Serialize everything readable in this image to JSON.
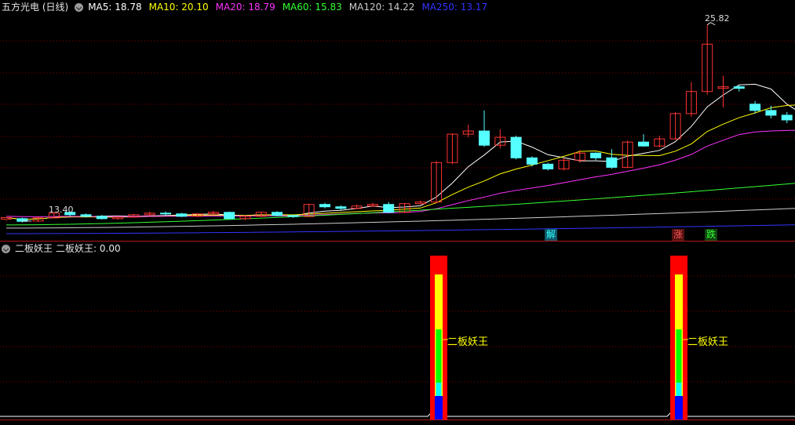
{
  "header": {
    "title": "五方光电 (日线)",
    "ma": [
      {
        "label": "MA5: 18.78",
        "color": "#ffffff"
      },
      {
        "label": "MA10: 20.10",
        "color": "#ffff00"
      },
      {
        "label": "MA20: 18.79",
        "color": "#ff33ff"
      },
      {
        "label": "MA60: 15.83",
        "color": "#33ff33"
      },
      {
        "label": "MA120: 14.22",
        "color": "#cccccc"
      },
      {
        "label": "MA250: 13.17",
        "color": "#3333ff"
      }
    ]
  },
  "price_labels": {
    "high": "25.82",
    "low": "13.40"
  },
  "markers": [
    {
      "text": "解",
      "color": "#33ffff",
      "bg": "#115566"
    },
    {
      "text": "涨",
      "color": "#ff5555",
      "bg": "#551111"
    },
    {
      "text": "跌",
      "color": "#33ff33",
      "bg": "#114411"
    }
  ],
  "indicator": {
    "name": "二板妖王",
    "value_label": "二板妖王: 0.00",
    "annotation": "二板妖王"
  },
  "colors": {
    "up": "#ff3333",
    "down": "#55ffff",
    "grid": "#8b0000",
    "separator": "#b01818",
    "ma5": "#ffffff",
    "ma10": "#ffff00",
    "ma20": "#ff33ff",
    "ma60": "#33ff33",
    "ma120": "#cccccc",
    "ma250": "#3333ff"
  },
  "chart_data": {
    "type": "candlestick",
    "candles": [
      [
        13.52,
        13.62,
        13.45,
        13.4
      ],
      [
        13.55,
        13.38,
        13.62,
        13.3
      ],
      [
        13.4,
        13.6,
        13.68,
        13.35
      ],
      [
        13.6,
        13.9,
        13.95,
        13.55
      ],
      [
        13.95,
        13.8,
        14.0,
        13.7
      ],
      [
        13.8,
        13.7,
        13.88,
        13.62
      ],
      [
        13.7,
        13.55,
        13.78,
        13.5
      ],
      [
        13.55,
        13.65,
        13.72,
        13.5
      ],
      [
        13.65,
        13.8,
        13.85,
        13.6
      ],
      [
        13.8,
        13.9,
        13.98,
        13.7
      ],
      [
        13.9,
        13.85,
        14.0,
        13.75
      ],
      [
        13.85,
        13.7,
        13.92,
        13.65
      ],
      [
        13.7,
        13.85,
        13.9,
        13.65
      ],
      [
        13.85,
        13.95,
        14.05,
        13.8
      ],
      [
        13.95,
        13.55,
        14.0,
        13.5
      ],
      [
        13.55,
        13.7,
        13.75,
        13.45
      ],
      [
        13.7,
        13.95,
        14.0,
        13.65
      ],
      [
        13.95,
        13.75,
        14.02,
        13.7
      ],
      [
        13.75,
        13.68,
        13.8,
        13.6
      ],
      [
        13.68,
        14.45,
        14.5,
        13.65
      ],
      [
        14.45,
        14.3,
        14.55,
        14.2
      ],
      [
        14.3,
        14.2,
        14.4,
        14.1
      ],
      [
        14.2,
        14.35,
        14.45,
        14.15
      ],
      [
        14.35,
        14.45,
        14.55,
        14.3
      ],
      [
        14.45,
        13.95,
        14.6,
        13.9
      ],
      [
        13.95,
        14.5,
        14.55,
        13.9
      ],
      [
        14.5,
        14.6,
        14.7,
        14.45
      ],
      [
        14.6,
        17.1,
        17.2,
        14.55
      ],
      [
        17.1,
        18.9,
        18.95,
        17.0
      ],
      [
        18.9,
        19.1,
        19.5,
        18.7
      ],
      [
        19.1,
        18.2,
        20.4,
        18.1
      ],
      [
        18.2,
        18.7,
        19.2,
        18.0
      ],
      [
        18.7,
        17.4,
        18.8,
        17.3
      ],
      [
        17.4,
        17.0,
        17.5,
        16.85
      ],
      [
        17.0,
        16.7,
        17.1,
        16.6
      ],
      [
        16.7,
        17.25,
        17.4,
        16.6
      ],
      [
        17.25,
        17.7,
        17.9,
        17.1
      ],
      [
        17.7,
        17.4,
        17.75,
        17.25
      ],
      [
        17.4,
        16.8,
        17.95,
        16.7
      ],
      [
        16.8,
        18.4,
        18.5,
        16.75
      ],
      [
        18.4,
        18.15,
        18.9,
        18.1
      ],
      [
        18.15,
        18.6,
        18.8,
        18.05
      ],
      [
        18.6,
        20.2,
        20.3,
        18.55
      ],
      [
        20.2,
        21.6,
        22.2,
        20.0
      ],
      [
        21.6,
        24.6,
        25.82,
        21.4
      ],
      [
        21.8,
        21.9,
        22.6,
        20.6
      ],
      [
        21.9,
        21.8,
        22.0,
        21.6
      ],
      [
        20.8,
        20.4,
        21.0,
        20.2
      ],
      [
        20.4,
        20.1,
        20.7,
        19.9
      ],
      [
        20.1,
        19.8,
        20.3,
        19.6
      ],
      [
        19.4,
        18.7,
        19.6,
        18.4
      ]
    ],
    "ylim": [
      12.5,
      26.5
    ]
  }
}
